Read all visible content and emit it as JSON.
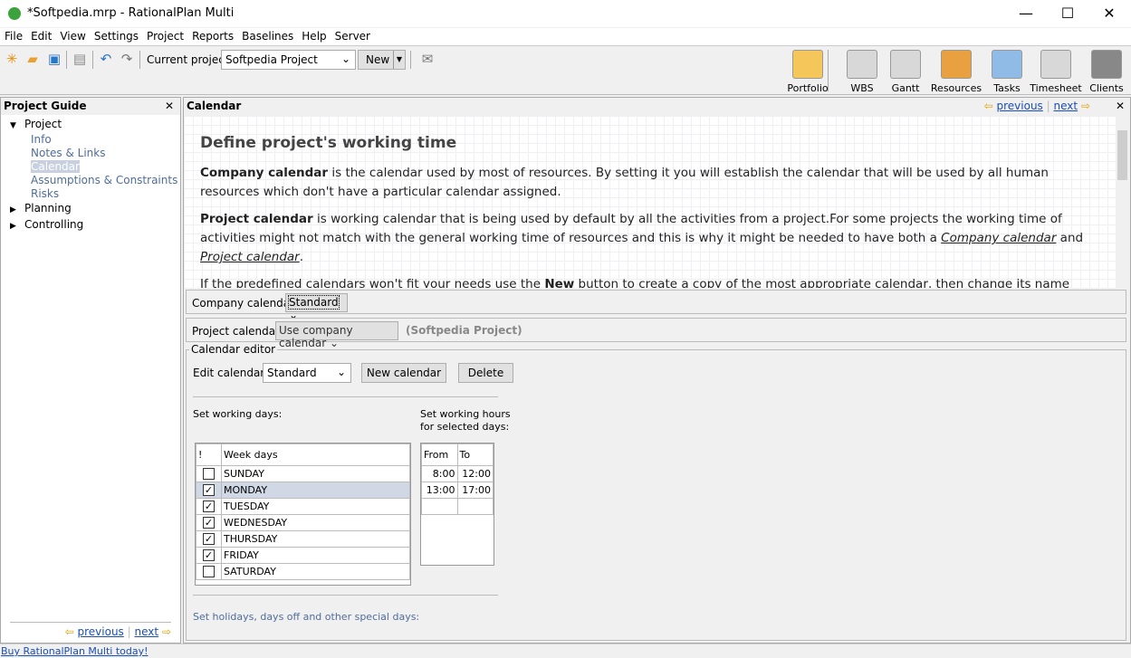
{
  "window": {
    "title": "*Softpedia.mrp - RationalPlan Multi",
    "minimize": "—",
    "maximize": "☐",
    "close": "✕"
  },
  "menu": [
    "File",
    "Edit",
    "View",
    "Settings",
    "Project",
    "Reports",
    "Baselines",
    "Help",
    "Server"
  ],
  "toolbar": {
    "current_project_label": "Current project:",
    "current_project_value": "Softpedia Project",
    "new_label": "New",
    "big": [
      {
        "label": "Portfolio",
        "icon": "portfolio-icon",
        "color": "#f5c65a"
      },
      {
        "label": "WBS",
        "icon": "wbs-icon",
        "color": "#d8d8d8"
      },
      {
        "label": "Gantt",
        "icon": "gantt-icon",
        "color": "#d8d8d8"
      },
      {
        "label": "Resources",
        "icon": "resources-icon",
        "color": "#e8a040"
      },
      {
        "label": "Tasks",
        "icon": "tasks-icon",
        "color": "#8fbbe6"
      },
      {
        "label": "Timesheet",
        "icon": "timesheet-icon",
        "color": "#d8d8d8"
      },
      {
        "label": "Clients",
        "icon": "clients-icon",
        "color": "#888888"
      }
    ]
  },
  "guide": {
    "title": "Project Guide",
    "items": [
      {
        "label": "Project",
        "level": 0,
        "expanded": true
      },
      {
        "label": "Info",
        "level": 1
      },
      {
        "label": "Notes & Links",
        "level": 1
      },
      {
        "label": "Calendar",
        "level": 1,
        "selected": true
      },
      {
        "label": "Assumptions & Constraints",
        "level": 1
      },
      {
        "label": "Risks",
        "level": 1
      },
      {
        "label": "Planning",
        "level": 0,
        "expanded": false
      },
      {
        "label": "Controlling",
        "level": 0,
        "expanded": false
      }
    ],
    "previous": "previous",
    "next": "next"
  },
  "main": {
    "title": "Calendar",
    "previous": "previous",
    "next": "next",
    "heading": "Define project's working time",
    "p1_bold": "Company calendar",
    "p1": " is the calendar used by most of resources. By setting it you will establish the calendar that will be used by all human resources which don't have a particular calendar assigned.",
    "p2_bold": "Project calendar",
    "p2": " is working calendar that is being used by default by all the activities from a project.For some projects the working time of activities might not match with the general working time of resources and this is why it might be needed to have both a ",
    "p2_link1": "Company calendar",
    "p2_and": " and ",
    "p2_link2": "Project calendar",
    "p2_end": ".",
    "p3": "If the predefined calendars won't fit your needs use the ",
    "p3_bold": "New",
    "p3_end": " button to create a copy of the most appropriate calendar, then change its name with a"
  },
  "company_calendar": {
    "label": "Company calendar:",
    "value": "Standard"
  },
  "project_calendar": {
    "label": "Project calendar:",
    "value": "Use company calendar",
    "note": "(Softpedia Project)"
  },
  "editor": {
    "title": "Calendar editor",
    "edit_label": "Edit calendar:",
    "edit_value": "Standard",
    "new_calendar": "New calendar",
    "delete": "Delete",
    "working_days_label": "Set working days:",
    "working_hours_label": "Set working hours\nfor selected days:",
    "days_header": [
      "!",
      "Week days"
    ],
    "days": [
      {
        "name": "SUNDAY",
        "checked": false
      },
      {
        "name": "MONDAY",
        "checked": true,
        "selected": true
      },
      {
        "name": "TUESDAY",
        "checked": true
      },
      {
        "name": "WEDNESDAY",
        "checked": true
      },
      {
        "name": "THURSDAY",
        "checked": true
      },
      {
        "name": "FRIDAY",
        "checked": true
      },
      {
        "name": "SATURDAY",
        "checked": false
      }
    ],
    "hours_header": [
      "From",
      "To"
    ],
    "hours": [
      [
        "8:00",
        "12:00"
      ],
      [
        "13:00",
        "17:00"
      ]
    ],
    "holidays_label": "Set holidays, days off and other special days:"
  },
  "status": {
    "link": "Buy RationalPlan Multi today!"
  }
}
